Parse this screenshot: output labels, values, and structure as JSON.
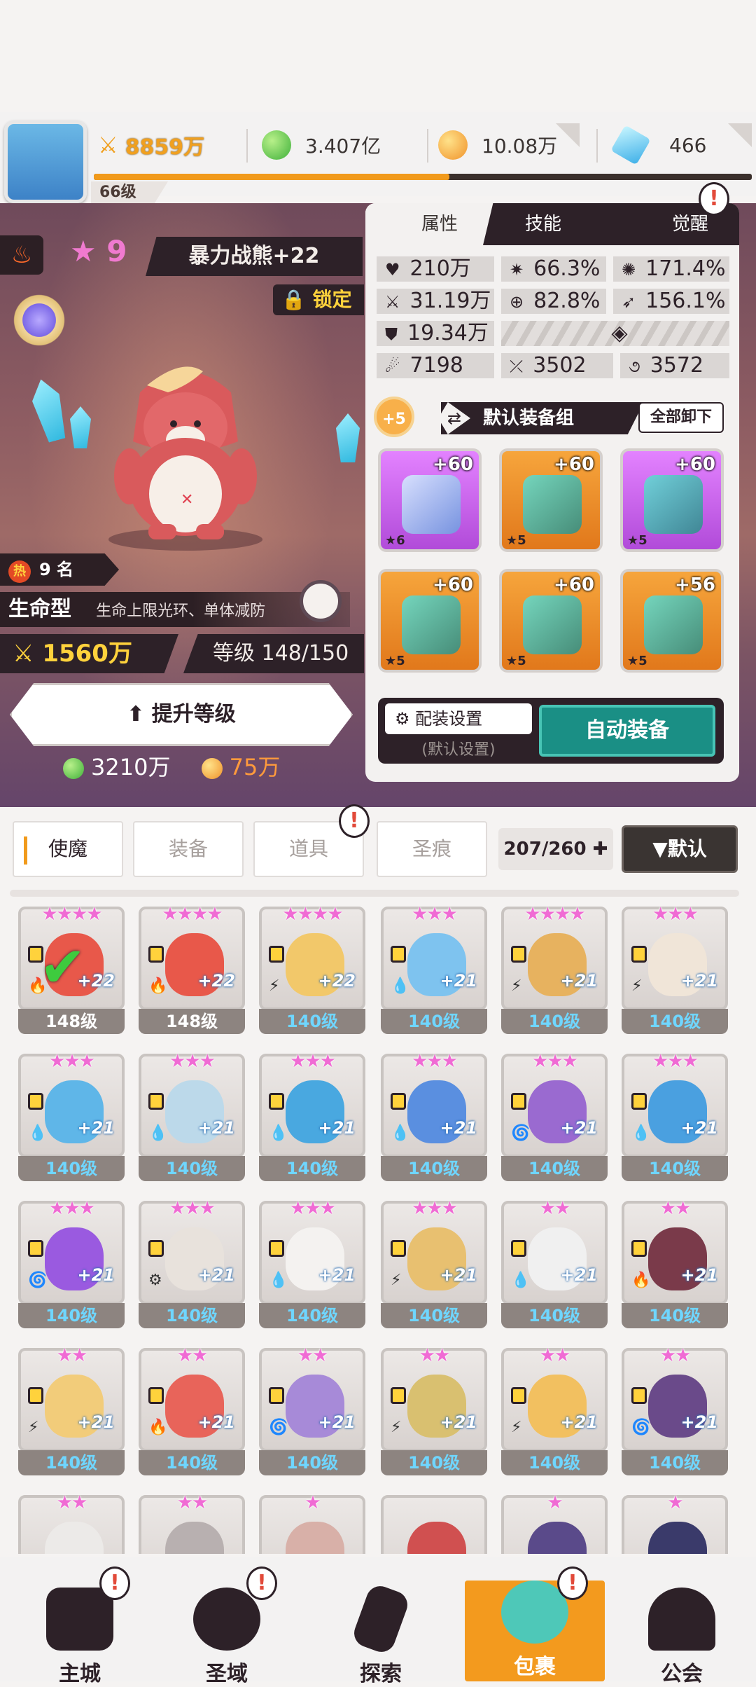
{
  "top": {
    "player_level": "66级",
    "power": "8859万",
    "gems": "3.407亿",
    "gold": "10.08万",
    "diamonds": "466"
  },
  "hero": {
    "stars": "9",
    "name": "暴力战熊+22",
    "lock_label": "锁定",
    "rank": "9 名",
    "rank_hot": "热",
    "type": "生命型",
    "type_desc": "生命上限光环、单体减防",
    "power": "1560万",
    "level": "等级 148/150",
    "upgrade_label": "提升等级",
    "cost_gem": "3210万",
    "cost_gold": "75万"
  },
  "panel": {
    "tabs": [
      "属性",
      "技能",
      "觉醒"
    ],
    "stats": [
      {
        "icon": "heart-icon",
        "value": "210万"
      },
      {
        "icon": "burst-icon",
        "value": "66.3%"
      },
      {
        "icon": "sun-icon",
        "value": "171.4%"
      },
      {
        "icon": "sword-icon",
        "value": "31.19万"
      },
      {
        "icon": "target-icon",
        "value": "82.8%"
      },
      {
        "icon": "wing-icon",
        "value": "156.1%"
      },
      {
        "icon": "shield-icon",
        "value": "19.34万"
      },
      {
        "icon": "claw-icon",
        "value": "7198"
      },
      {
        "icon": "slash-icon",
        "value": "3502"
      },
      {
        "icon": "swirl-icon",
        "value": "3572"
      }
    ],
    "equip_plus": "+5",
    "equip_group": "默认装备组",
    "unequip_all": "全部卸下",
    "slots": [
      {
        "plus": "+60",
        "stars": "★6",
        "color": "purple"
      },
      {
        "plus": "+60",
        "stars": "★5",
        "color": "orange"
      },
      {
        "plus": "+60",
        "stars": "★5",
        "color": "purple"
      },
      {
        "plus": "+60",
        "stars": "★5",
        "color": "orange"
      },
      {
        "plus": "+60",
        "stars": "★5",
        "color": "orange"
      },
      {
        "plus": "+56",
        "stars": "★5",
        "color": "orange"
      }
    ],
    "config_label": "配装设置",
    "config_sub": "(默认设置)",
    "auto_label": "自动装备"
  },
  "filter": {
    "tabs": [
      "使魔",
      "装备",
      "道具",
      "圣痕"
    ],
    "count": "207/260",
    "sort": "▼默认"
  },
  "cards": [
    {
      "stars": "★★★★",
      "level": "148级",
      "plus": "+22",
      "elem": "🔥",
      "color": "#e8584a",
      "check": true
    },
    {
      "stars": "★★★★",
      "level": "148级",
      "plus": "+22",
      "elem": "🔥",
      "color": "#e8584a"
    },
    {
      "stars": "★★★★",
      "level": "140级",
      "plus": "+22",
      "elem": "⚡",
      "color": "#f2c86a"
    },
    {
      "stars": "★★★",
      "level": "140级",
      "plus": "+21",
      "elem": "💧",
      "color": "#7ec3ef"
    },
    {
      "stars": "★★★★",
      "level": "140级",
      "plus": "+21",
      "elem": "⚡",
      "color": "#e7b25f"
    },
    {
      "stars": "★★★",
      "level": "140级",
      "plus": "+21",
      "elem": "⚡",
      "color": "#f0e5d8"
    },
    {
      "stars": "★★★",
      "level": "140级",
      "plus": "+21",
      "elem": "💧",
      "color": "#5fb6e8"
    },
    {
      "stars": "★★★",
      "level": "140级",
      "plus": "+21",
      "elem": "💧",
      "color": "#bcd9ea"
    },
    {
      "stars": "★★★",
      "level": "140级",
      "plus": "+21",
      "elem": "💧",
      "color": "#49a8e0"
    },
    {
      "stars": "★★★",
      "level": "140级",
      "plus": "+21",
      "elem": "💧",
      "color": "#5a8fe0"
    },
    {
      "stars": "★★★",
      "level": "140级",
      "plus": "+21",
      "elem": "🌀",
      "color": "#9a6ad0"
    },
    {
      "stars": "★★★",
      "level": "140级",
      "plus": "+21",
      "elem": "💧",
      "color": "#4aa0e0"
    },
    {
      "stars": "★★★",
      "level": "140级",
      "plus": "+21",
      "elem": "🌀",
      "color": "#9a5ae0"
    },
    {
      "stars": "★★★",
      "level": "140级",
      "plus": "+21",
      "elem": "⚙",
      "color": "#e8e2dc"
    },
    {
      "stars": "★★★",
      "level": "140级",
      "plus": "+21",
      "elem": "💧",
      "color": "#f4f2f0"
    },
    {
      "stars": "★★★",
      "level": "140级",
      "plus": "+21",
      "elem": "⚡",
      "color": "#e8c070"
    },
    {
      "stars": "★★",
      "level": "140级",
      "plus": "+21",
      "elem": "💧",
      "color": "#f0f0f0"
    },
    {
      "stars": "★★",
      "level": "140级",
      "plus": "+21",
      "elem": "🔥",
      "color": "#7a3a4a"
    },
    {
      "stars": "★★",
      "level": "140级",
      "plus": "+21",
      "elem": "⚡",
      "color": "#f2cc7a"
    },
    {
      "stars": "★★",
      "level": "140级",
      "plus": "+21",
      "elem": "🔥",
      "color": "#e8645a"
    },
    {
      "stars": "★★",
      "level": "140级",
      "plus": "+21",
      "elem": "🌀",
      "color": "#a78ad8"
    },
    {
      "stars": "★★",
      "level": "140级",
      "plus": "+21",
      "elem": "⚡",
      "color": "#d9c070"
    },
    {
      "stars": "★★",
      "level": "140级",
      "plus": "+21",
      "elem": "⚡",
      "color": "#f2c060"
    },
    {
      "stars": "★★",
      "level": "140级",
      "plus": "+21",
      "elem": "🌀",
      "color": "#6a4a8a"
    },
    {
      "stars": "★★",
      "level": "",
      "plus": "",
      "elem": "",
      "color": "#eceae8"
    },
    {
      "stars": "★★",
      "level": "",
      "plus": "",
      "elem": "",
      "color": "#b8b0b0"
    },
    {
      "stars": "★",
      "level": "",
      "plus": "",
      "elem": "",
      "color": "#d8b0a8"
    },
    {
      "stars": "",
      "level": "",
      "plus": "",
      "elem": "",
      "color": "#d05050"
    },
    {
      "stars": "★",
      "level": "",
      "plus": "",
      "elem": "",
      "color": "#5a4a8a"
    },
    {
      "stars": "★",
      "level": "",
      "plus": "",
      "elem": "",
      "color": "#3a3a6a"
    }
  ],
  "nav": [
    "主城",
    "圣域",
    "探索",
    "包裹",
    "公会"
  ]
}
